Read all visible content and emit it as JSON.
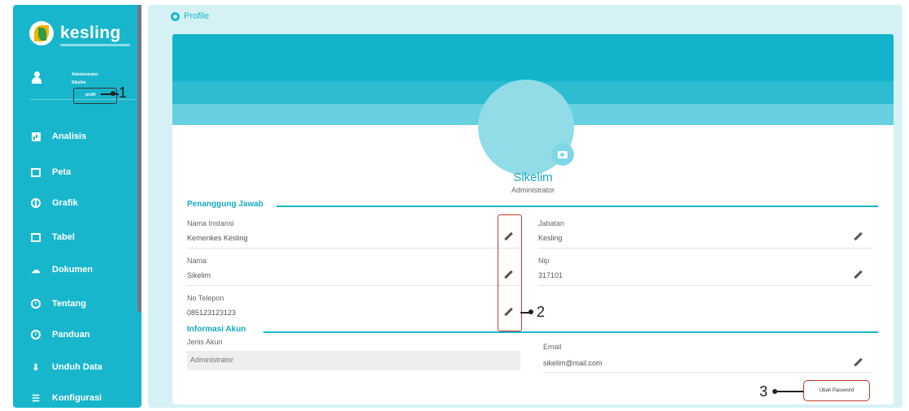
{
  "brand": {
    "name": "kesling"
  },
  "user": {
    "role": "Administrator",
    "name": "Sikelim",
    "profile_link": "profil"
  },
  "callouts": {
    "one": "1",
    "two": "2",
    "three": "3"
  },
  "nav": {
    "items": [
      {
        "label": "Analisis",
        "icon": "bar-chart-icon"
      },
      {
        "label": "Peta",
        "icon": "map-icon"
      },
      {
        "label": "Grafik",
        "icon": "chart-icon"
      },
      {
        "label": "Tabel",
        "icon": "table-icon"
      },
      {
        "label": "Dokumen",
        "icon": "document-icon"
      },
      {
        "label": "Tentang",
        "icon": "info-icon"
      },
      {
        "label": "Panduan",
        "icon": "info-icon"
      },
      {
        "label": "Unduh Data",
        "icon": "download-icon"
      },
      {
        "label": "Konfigurasi",
        "icon": "sliders-icon"
      }
    ]
  },
  "breadcrumb": {
    "label": "Profile"
  },
  "profile": {
    "name": "Sikelim",
    "role": "Administrator"
  },
  "sections": {
    "penanggung": "Penanggung Jawab",
    "akun": "Informasi Akun"
  },
  "fields": {
    "nama_instansi": {
      "label": "Nama Instansi",
      "value": "Kemenkes Kesling"
    },
    "jabatan": {
      "label": "Jabatan",
      "value": "Kesling"
    },
    "nama": {
      "label": "Nama",
      "value": "Sikelim"
    },
    "nip": {
      "label": "Nip",
      "value": "317101"
    },
    "telepon": {
      "label": "No Telepon",
      "value": "085123123123"
    },
    "jenis_akun": {
      "label": "Jenis Akun",
      "value": "Administrator"
    },
    "email": {
      "label": "Email",
      "value": "sikelim@mail.com"
    }
  },
  "buttons": {
    "ubah_password": "Ubah Password"
  },
  "colors": {
    "accent": "#18b6cc",
    "highlight": "#c0392b",
    "background": "#d6f1f6"
  }
}
